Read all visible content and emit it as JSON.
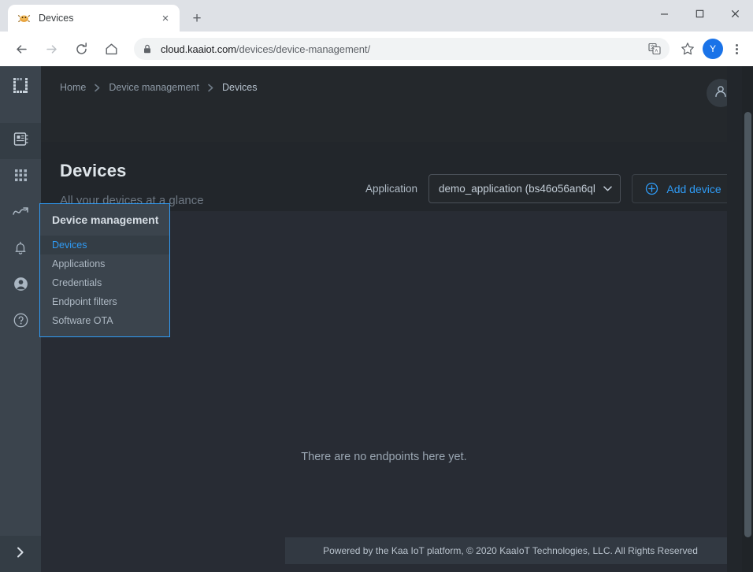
{
  "browser": {
    "tab": {
      "title": "Devices",
      "favicon": "kaa-bug-favicon",
      "close_label": "×"
    },
    "new_tab_label": "+",
    "window_controls": {
      "minimize": "—",
      "maximize": "□",
      "close": "✕"
    },
    "nav": {
      "back": "←",
      "forward": "→",
      "reload": "↻",
      "home": "⌂"
    },
    "omnibox": {
      "secure_icon": "lock-icon",
      "url_domain": "cloud.kaaiot.com",
      "url_path": "/devices/device-management/",
      "full_url": "cloud.kaaiot.com/devices/device-management/"
    },
    "actions": {
      "translate": "translate-icon",
      "bookmark": "star-icon",
      "profile_initial": "Y",
      "menu": "kebab-menu-icon"
    }
  },
  "rail": {
    "logo": "kaa-bracket-logo",
    "items": [
      {
        "name": "device-management",
        "icon": "device-board-icon",
        "active": true
      },
      {
        "name": "solutions",
        "icon": "grid-apps-icon",
        "active": false
      },
      {
        "name": "analytics",
        "icon": "chart-line-icon",
        "active": false
      },
      {
        "name": "alerts",
        "icon": "bell-icon",
        "active": false
      },
      {
        "name": "account",
        "icon": "user-circle-icon",
        "active": false
      },
      {
        "name": "help",
        "icon": "question-circle-icon",
        "active": false
      }
    ],
    "expand": "chevron-right-icon"
  },
  "header": {
    "breadcrumb": [
      {
        "label": "Home",
        "current": false
      },
      {
        "label": "Device management",
        "current": false
      },
      {
        "label": "Devices",
        "current": true
      }
    ],
    "account_icon": "person-icon",
    "title": "Devices",
    "subtitle": "All your devices at a glance",
    "application_label": "Application",
    "application_value": "demo_application (bs46o56an6ql",
    "application_caret": "▼",
    "add_device_label": "Add device",
    "add_device_icon": "plus-circle-icon"
  },
  "flyout": {
    "title": "Device management",
    "items": [
      {
        "label": "Devices",
        "active": true
      },
      {
        "label": "Applications",
        "active": false
      },
      {
        "label": "Credentials",
        "active": false
      },
      {
        "label": "Endpoint filters",
        "active": false
      },
      {
        "label": "Software OTA",
        "active": false
      }
    ]
  },
  "main": {
    "empty_state": "There are no endpoints here yet."
  },
  "footer": {
    "text": "Powered by the Kaa IoT platform, © 2020 KaaIoT Technologies, LLC. All Rights Reserved"
  },
  "colors": {
    "accent_blue": "#2f9bf5",
    "rail_bg": "#3b444d",
    "header_bg": "#24282c",
    "card_bg": "#282c34",
    "page_bg": "#22262b",
    "footer_bg": "#323942",
    "browser_chrome": "#dee1e6",
    "profile_chip": "#1a73e8"
  }
}
